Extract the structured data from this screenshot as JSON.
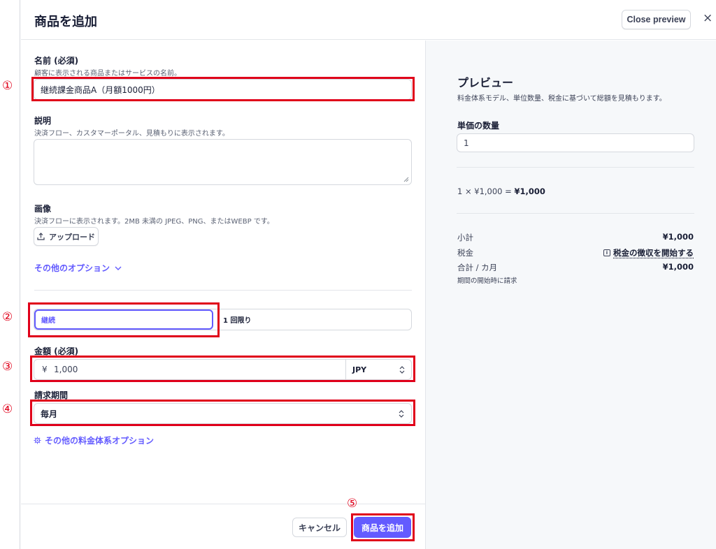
{
  "header": {
    "title": "商品を追加",
    "close_preview_label": "Close preview",
    "close_glyph": "×"
  },
  "callouts": {
    "c1": "①",
    "c2": "②",
    "c3": "③",
    "c4": "④",
    "c5": "⑤"
  },
  "form": {
    "name": {
      "label": "名前 (必須)",
      "help": "顧客に表示される商品またはサービスの名前。",
      "value": "継続課金商品A（月額1000円）"
    },
    "description": {
      "label": "説明",
      "help": "決済フロー、カスタマーポータル、見積もりに表示されます。",
      "value": ""
    },
    "image": {
      "label": "画像",
      "help": "決済フローに表示されます。2MB 未満の JPEG、PNG、またはWEBP です。",
      "upload_label": "アップロード"
    },
    "more_options_label": "その他のオプション",
    "billing_type": {
      "options": [
        "継続",
        "1 回限り"
      ],
      "selected": "継続"
    },
    "amount": {
      "label": "金額 (必須)",
      "currency_symbol": "¥",
      "value": "1,000",
      "currency": "JPY"
    },
    "billing_period": {
      "label": "請求期間",
      "value": "毎月"
    },
    "pricing_options_label": "その他の料金体系オプション",
    "footer": {
      "cancel_label": "キャンセル",
      "submit_label": "商品を追加"
    }
  },
  "preview": {
    "title": "プレビュー",
    "description": "料金体系モデル、単位数量、税金に基づいて総額を見積もります。",
    "quantity_label": "単価の数量",
    "quantity_value": "1",
    "calc_prefix": "1 × ¥1,000 = ",
    "calc_total": "¥1,000",
    "subtotal_label": "小計",
    "subtotal_value": "¥1,000",
    "tax_label": "税金",
    "tax_link": "税金の徴収を開始する",
    "total_label": "合計 / カ月",
    "total_value": "¥1,000",
    "total_note": "期間の開始時に請求"
  },
  "colors": {
    "accent": "#635bff",
    "annotation": "#e0001a"
  }
}
